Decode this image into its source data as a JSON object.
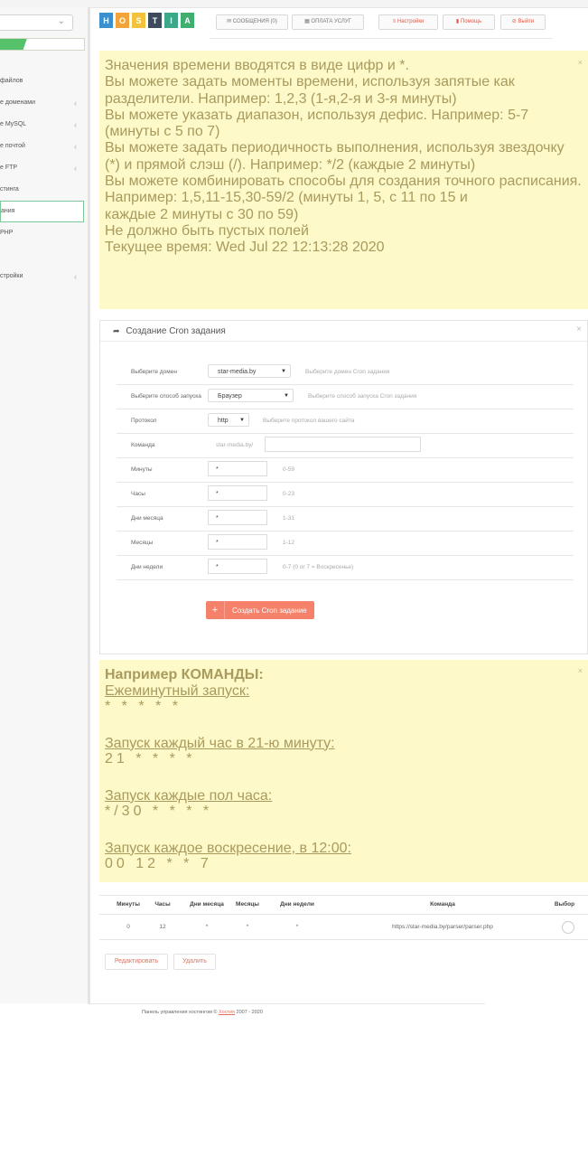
{
  "colors": {
    "note_bg": "#fdf9c8",
    "note_text": "#a99a5e",
    "accent_red": "#f5816a",
    "progress_green": "#55c16b",
    "logo_letters": [
      "#3a8fcf",
      "#f2a43b",
      "#f2c23b",
      "#3d4a5c",
      "#3aa889",
      "#3fae6e"
    ]
  },
  "sidebar": {
    "progress": 0.32,
    "items": [
      {
        "label": "файлов",
        "arrow": false
      },
      {
        "label": "е доменами",
        "arrow": true
      },
      {
        "label": "е MySQL",
        "arrow": true
      },
      {
        "label": "е почтой",
        "arrow": true
      },
      {
        "label": "е FTP",
        "arrow": true
      },
      {
        "label": "стинга",
        "arrow": false
      },
      {
        "label": "ания",
        "arrow": false,
        "active": true
      },
      {
        "label": "PHP",
        "arrow": false
      }
    ],
    "settings_item": "стройки",
    "arrow_glyph": "‹"
  },
  "header": {
    "logo_letters": [
      "H",
      "O",
      "S",
      "T",
      "I",
      "A"
    ],
    "messages": "✉ СООБЩЕНИЯ (0)",
    "payment": "▦ ОПЛАТА УСЛУГ",
    "settings": "≡ Настройки",
    "help": "▮ Помощь",
    "logout": "⊘ Выйти"
  },
  "info_note": {
    "lines": [
      "Значения времени вводятся в виде цифр и *.",
      "Вы можете задать моменты времени, используя запятые как разделители. Например: 1,2,3 (1-я,2-я и 3-я минуты)",
      "Вы можете указать диапазон, используя дефис. Например: 5-7 (минуты с 5 по 7)",
      "Вы можете задать периодичность выполнения, используя звездочку (*) и прямой слэш (/). Например: */2 (каждые 2 минуты)",
      "Вы можете комбинировать способы для создания точного расписания. Например: 1,5,11-15,30-59/2 (минуты 1, 5, с 11 по 15 и",
      "каждые 2 минуты с 30 по 59)",
      "Не должно быть пустых полей",
      "Текущее время: Wed Jul 22 12:13:28 2020"
    ]
  },
  "cron_form": {
    "title": "Создание Cron задания",
    "rows": {
      "domain": {
        "label": "Выберите домен",
        "value": "star-media.by",
        "hint": "Выберите домен Cron задания"
      },
      "launch": {
        "label": "Выберите способ запуска",
        "value": "Браузер",
        "hint": "Выберите способ запуска Cron задания"
      },
      "protocol": {
        "label": "Протокол",
        "value": "http",
        "hint": "Выберите протокол вашего сайта"
      },
      "command": {
        "label": "Команда",
        "prefix": "star-media.by/",
        "value": ""
      },
      "minutes": {
        "label": "Минуты",
        "value": "*",
        "hint": "0-59"
      },
      "hours": {
        "label": "Часы",
        "value": "*",
        "hint": "0-23"
      },
      "days": {
        "label": "Дни месяца",
        "value": "*",
        "hint": "1-31"
      },
      "months": {
        "label": "Месяцы",
        "value": "*",
        "hint": "1-12"
      },
      "weekdays": {
        "label": "Дни недели",
        "value": "*",
        "hint": "0-7 (0 or 7 = Воскресенье)"
      }
    },
    "submit": "Создать Cron задание"
  },
  "examples_note": {
    "title": "Например КОМАНДЫ:",
    "items": [
      {
        "caption": "Ежеминутный запуск:",
        "cmd": "* * * * *"
      },
      {
        "caption": "Запуск каждый час в 21-ю минуту:",
        "cmd": "21 * * * *"
      },
      {
        "caption": "Запуск каждые пол часа:",
        "cmd": "*/30 * * * *"
      },
      {
        "caption": "Запуск каждое воскресение, в 12:00:",
        "cmd": "00 12 * * 7"
      }
    ]
  },
  "jobs_table": {
    "headers": [
      "Минуты",
      "Часы",
      "Дни месяца",
      "Месяцы",
      "Дни недели",
      "Команда",
      "Выбор"
    ],
    "rows": [
      [
        "0",
        "12",
        "*",
        "*",
        "*",
        "https://star-media.by/parser/parser.php"
      ]
    ]
  },
  "actions": {
    "edit": "Редактировать",
    "delete": "Удалить"
  },
  "footer": {
    "prefix": "Панель управления хостингом © ",
    "link": "Хостия",
    "suffix": " 2007 - 2020"
  },
  "close_glyph": "×",
  "select_caret": "▼",
  "plus_glyph": "+",
  "share_glyph": "➦"
}
